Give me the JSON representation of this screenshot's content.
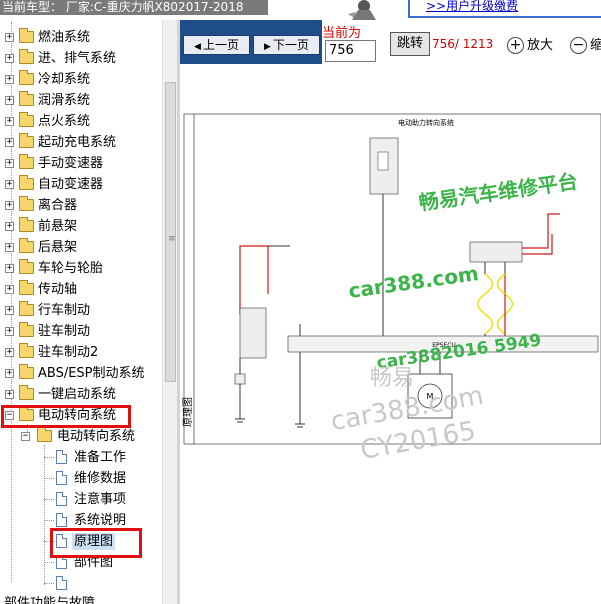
{
  "header": {
    "vehicle_title": "当前车型：  厂家:C-重庆力帆X802017-2018",
    "upgrade_link": ">>用户升级缴费"
  },
  "tree": {
    "items": [
      {
        "label": "燃油系统"
      },
      {
        "label": "进、排气系统"
      },
      {
        "label": "冷却系统"
      },
      {
        "label": "润滑系统"
      },
      {
        "label": "点火系统"
      },
      {
        "label": "起动充电系统"
      },
      {
        "label": "手动变速器"
      },
      {
        "label": "自动变速器"
      },
      {
        "label": "离合器"
      },
      {
        "label": "前悬架"
      },
      {
        "label": "后悬架"
      },
      {
        "label": "车轮与轮胎"
      },
      {
        "label": "传动轴"
      },
      {
        "label": "行车制动"
      },
      {
        "label": "驻车制动"
      },
      {
        "label": "驻车制动2"
      },
      {
        "label": "ABS/ESP制动系统"
      },
      {
        "label": "一键启动系统"
      },
      {
        "label": "电动转向系统"
      }
    ],
    "sub_folder": "电动转向系统",
    "docs": [
      "准备工作",
      "维修数据",
      "注意事项",
      "系统说明",
      "原理图",
      "部件图",
      ""
    ],
    "bottom_item": "部件功能与故障"
  },
  "toolbar": {
    "prev_label": "上一页",
    "next_label": "下一页",
    "current_page_label": "当前为",
    "current_page_value": "756",
    "jump_label": "跳转",
    "page_count": "756/ 1213",
    "zoom_in_label": "放大",
    "zoom_out_label": "缩"
  },
  "diagram": {
    "title": "电动助力转向系统",
    "ecu_label": "EPSECU",
    "side_label": "原理图",
    "watermarks": [
      "畅易汽车维修平台",
      "car388.com",
      "car3882016 5949",
      "畅易",
      "car388.com",
      "CY20165"
    ]
  },
  "colors": {
    "toolbar_bg": "#1f4d8a",
    "highlight": "#e01010",
    "page_count": "#d00000",
    "wire_red": "#d01818",
    "wire_yellow": "#f0e020",
    "watermark_green": "#3bb54a"
  }
}
